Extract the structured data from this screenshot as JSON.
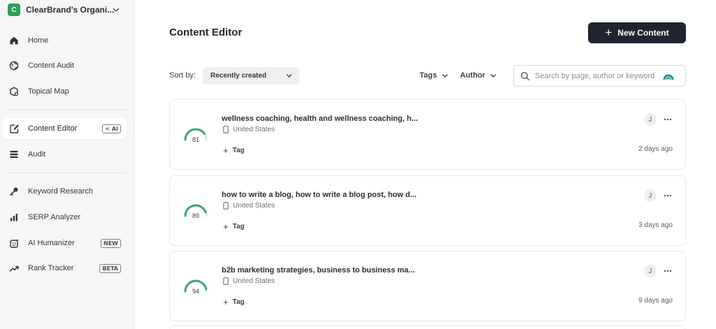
{
  "org": {
    "initial": "C",
    "name": "ClearBrand's Organi..."
  },
  "nav": {
    "home": "Home",
    "content_audit": "Content Audit",
    "topical_map": "Topical Map",
    "content_editor": "Content Editor",
    "content_editor_badge": "< AI",
    "audit": "Audit",
    "keyword_research": "Keyword Research",
    "serp_analyzer": "SERP Analyzer",
    "ai_humanizer": "AI Humanizer",
    "ai_humanizer_badge": "NEW",
    "rank_tracker": "Rank Tracker",
    "rank_tracker_badge": "BETA"
  },
  "header": {
    "title": "Content Editor",
    "new_button": "New Content"
  },
  "toolbar": {
    "sort_label": "Sort by:",
    "sort_value": "Recently created",
    "tags_label": "Tags",
    "author_label": "Author",
    "search_placeholder": "Search by page, author or keyword"
  },
  "colors": {
    "accent": "#2e9f5b",
    "button_dark": "#20242f",
    "gauge": "#3aa86b"
  },
  "items": [
    {
      "score": "81",
      "score_value": 81,
      "title": "wellness coaching, health and wellness coaching, h...",
      "location": "United States",
      "tag_label": "Tag",
      "author_initial": "J",
      "time": "2 days ago"
    },
    {
      "score": "89",
      "score_value": 89,
      "title": "how to write a blog, how to write a blog post, how d...",
      "location": "United States",
      "tag_label": "Tag",
      "author_initial": "J",
      "time": "3 days ago"
    },
    {
      "score": "94",
      "score_value": 94,
      "title": "b2b marketing strategies, business to business ma...",
      "location": "United States",
      "tag_label": "Tag",
      "author_initial": "J",
      "time": "9 days ago"
    }
  ]
}
